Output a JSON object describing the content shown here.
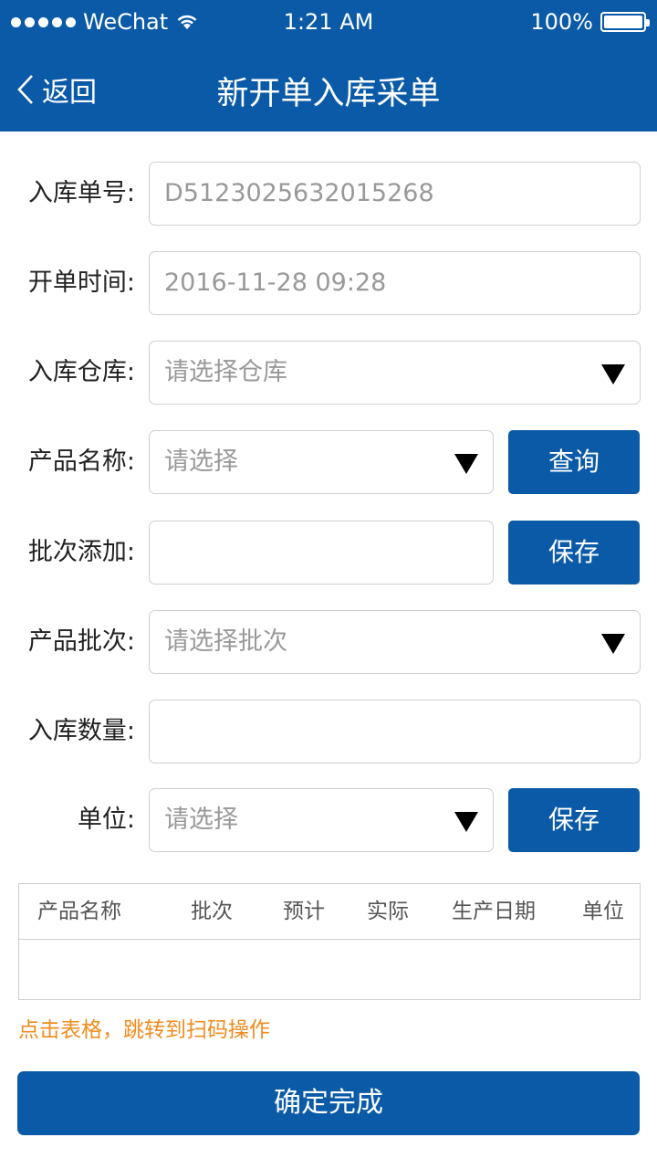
{
  "status_bar": {
    "carrier": "WeChat",
    "time": "1:21 AM",
    "battery": "100%"
  },
  "nav": {
    "back_label": "返回",
    "title": "新开单入库采单"
  },
  "form": {
    "order_no": {
      "label": "入库单号:",
      "value": "D5123025632015268"
    },
    "open_time": {
      "label": "开单时间:",
      "value": "2016-11-28 09:28"
    },
    "warehouse": {
      "label": "入库仓库:",
      "placeholder": "请选择仓库"
    },
    "product_name": {
      "label": "产品名称:",
      "placeholder": "请选择",
      "button": "查询"
    },
    "batch_add": {
      "label": "批次添加:",
      "value": "",
      "button": "保存"
    },
    "product_batch": {
      "label": "产品批次:",
      "placeholder": "请选择批次"
    },
    "quantity": {
      "label": "入库数量:",
      "value": ""
    },
    "unit": {
      "label": "单位:",
      "placeholder": "请选择",
      "button": "保存"
    }
  },
  "table": {
    "headers": [
      "产品名称",
      "批次",
      "预计",
      "实际",
      "生产日期",
      "单位"
    ],
    "rows": []
  },
  "hint": "点击表格，跳转到扫码操作",
  "confirm_label": "确定完成",
  "colors": {
    "primary": "#0a5aa8",
    "hint": "#f08c1e"
  },
  "icons": [
    "wifi-icon",
    "battery-icon",
    "chevron-left-icon",
    "dropdown-triangle-icon"
  ]
}
